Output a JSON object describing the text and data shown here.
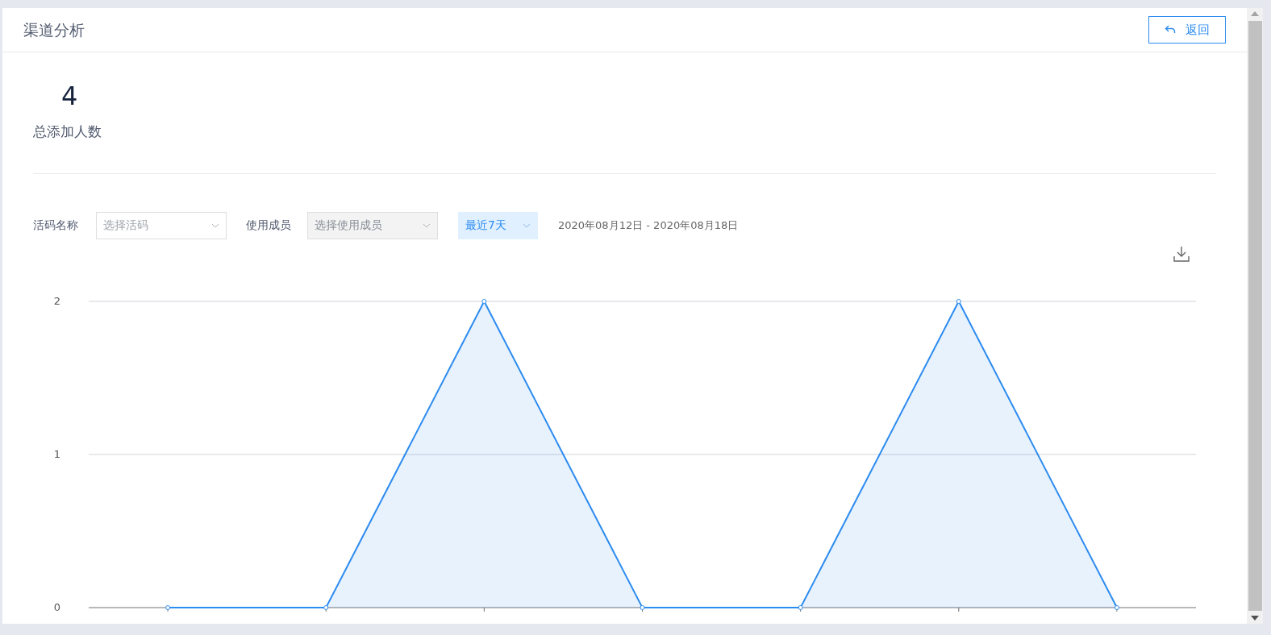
{
  "header": {
    "title": "渠道分析",
    "back_button": "返回"
  },
  "stats": {
    "value": "4",
    "label": "总添加人数"
  },
  "filters": {
    "code_label": "活码名称",
    "code_select": {
      "placeholder": "选择活码",
      "disabled": false
    },
    "member_label": "使用成员",
    "member_select": {
      "placeholder": "选择使用成员",
      "disabled": true
    },
    "range_select": {
      "value": "最近7天"
    },
    "date_range": "2020年08月12日 - 2020年08月18日"
  },
  "chart": {
    "chart_data": {
      "type": "area",
      "series": [
        {
          "color": "#2d8cf0",
          "values": [
            0,
            0,
            2,
            0,
            0,
            2,
            0
          ]
        }
      ],
      "ylim": [
        0,
        2
      ],
      "yticks": [
        0,
        1,
        2
      ]
    }
  }
}
